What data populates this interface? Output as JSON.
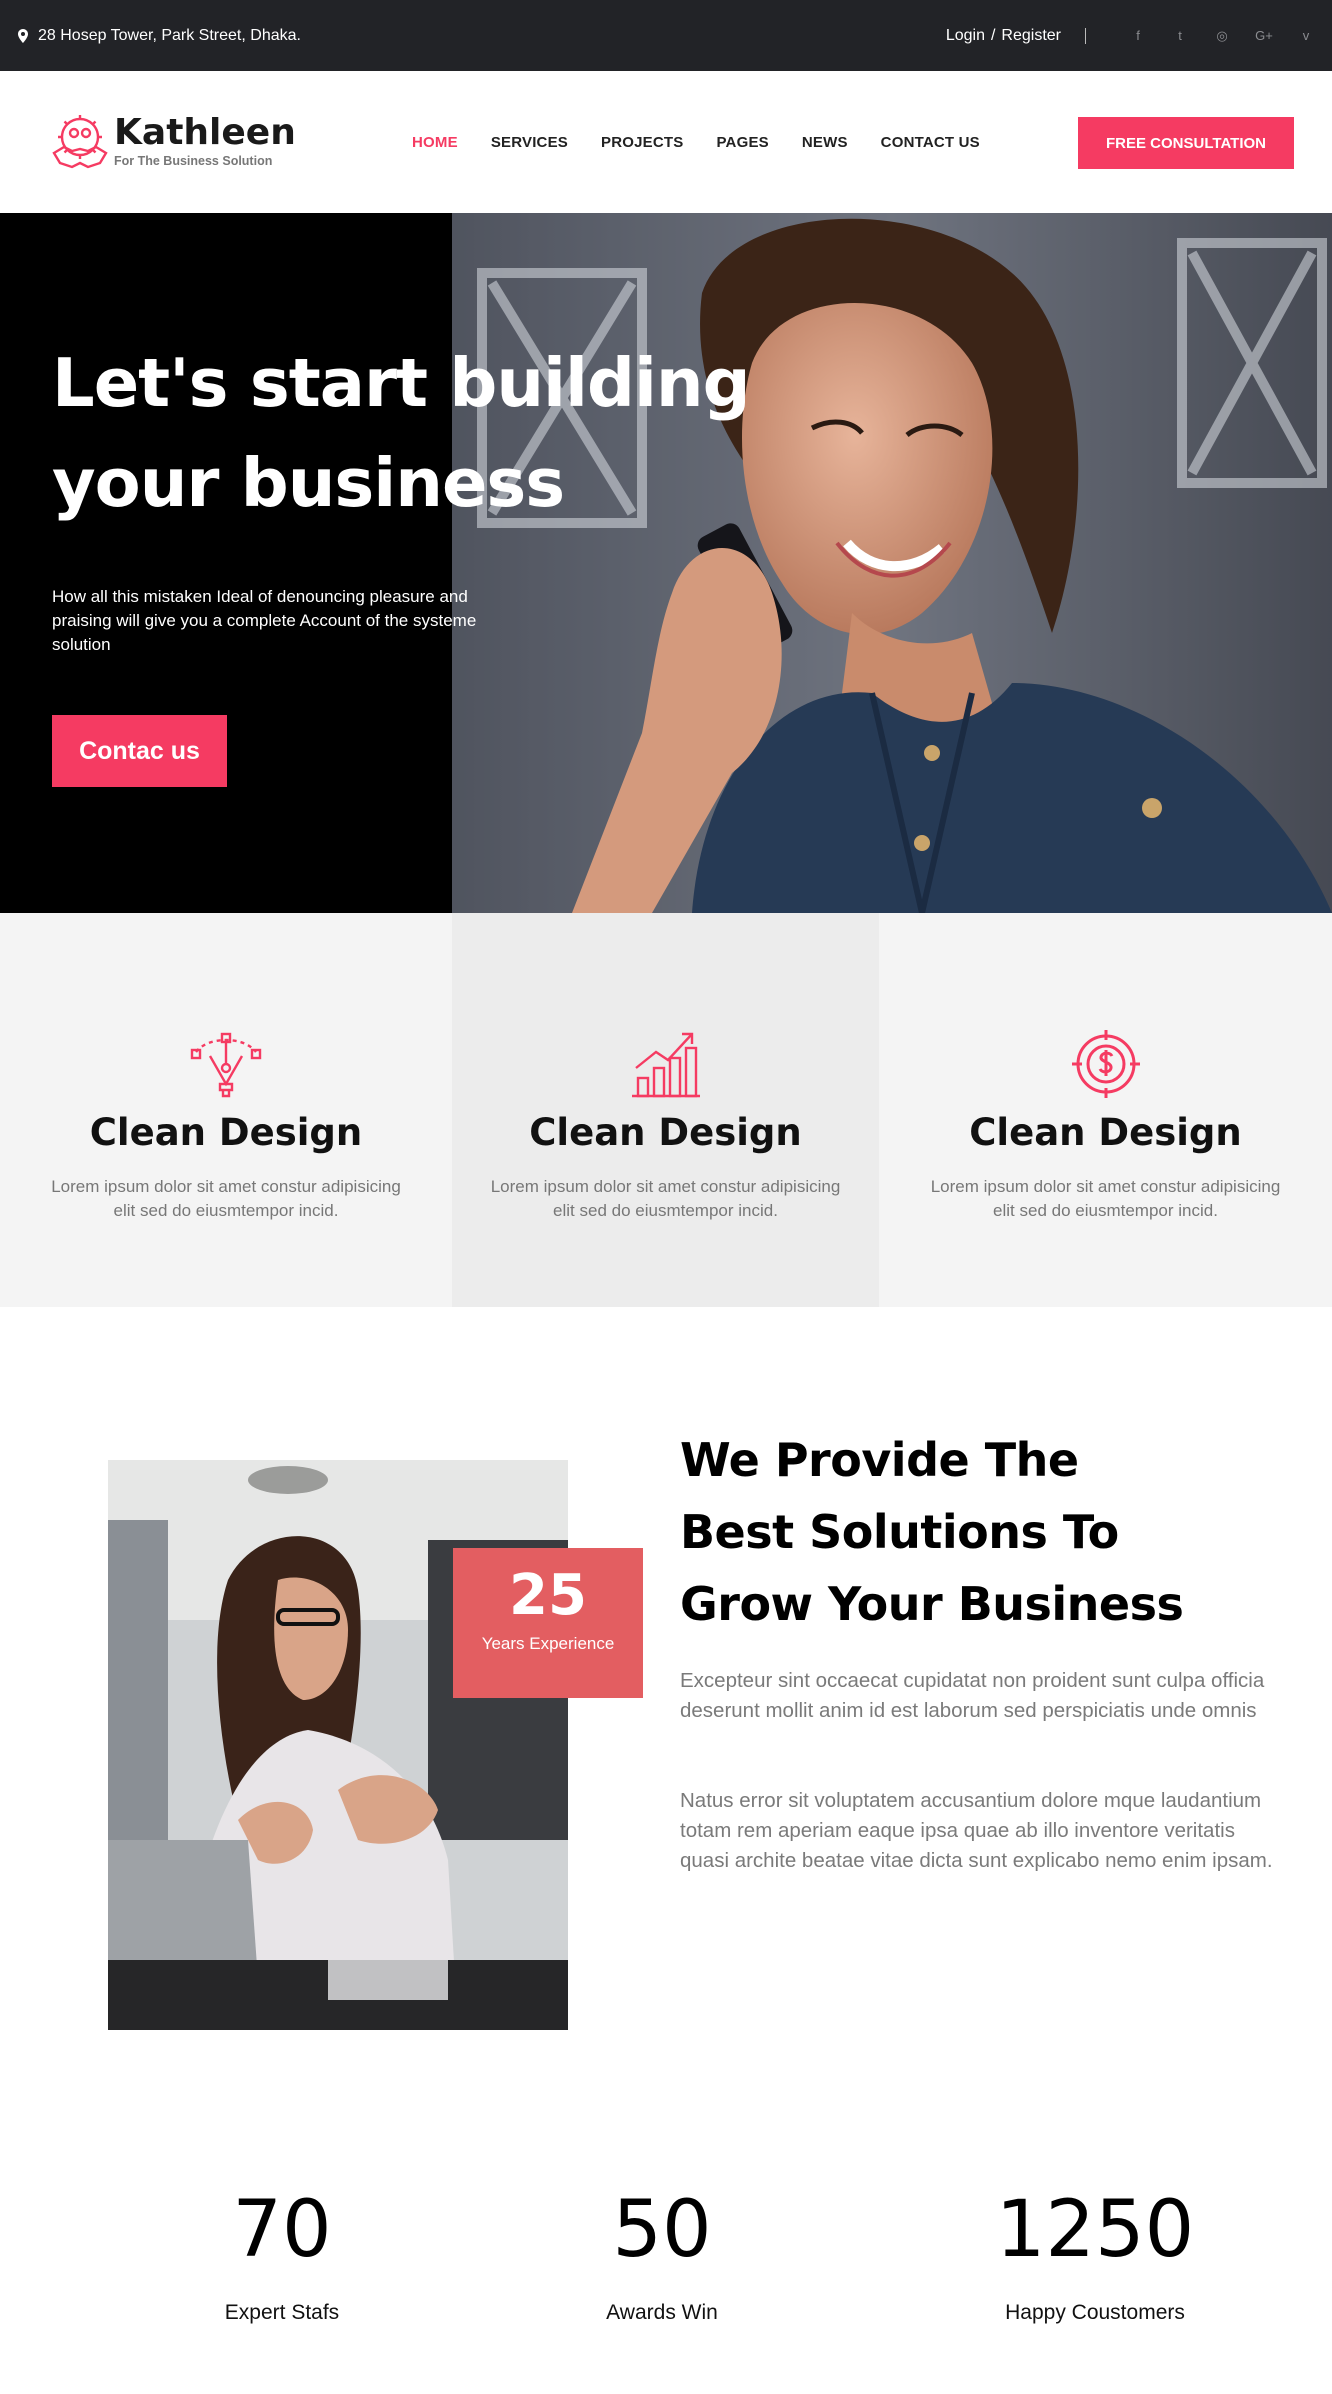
{
  "topbar": {
    "address": "28 Hosep Tower, Park Street, Dhaka.",
    "login": "Login",
    "separator": "/",
    "register": "Register",
    "social": [
      "facebook-icon",
      "twitter-icon",
      "dribbble-icon",
      "google-plus-icon",
      "vimeo-icon"
    ],
    "social_glyphs": [
      "f",
      "t",
      "◎",
      "G+",
      "v"
    ]
  },
  "header": {
    "brand": "Kathleen",
    "tagline": "For The Business Solution",
    "nav": [
      "HOME",
      "SERVICES",
      "PROJECTS",
      "PAGES",
      "NEWS",
      "CONTACT US"
    ],
    "active_nav": "HOME",
    "cta": "FREE CONSULTATION"
  },
  "hero": {
    "title_line1": "Let's start building",
    "title_line2": "your business",
    "lead": "How all this mistaken Ideal of denouncing pleasure  and praising will give you a complete Account of the systeme solution",
    "button": "Contac us"
  },
  "features": [
    {
      "icon": "pen-tool-icon",
      "title": "Clean Design",
      "text": "Lorem ipsum dolor sit amet constur adipisicing elit sed do eiusmtempor incid."
    },
    {
      "icon": "bar-chart-growth-icon",
      "title": "Clean Design",
      "text": "Lorem ipsum dolor sit amet constur adipisicing elit sed do eiusmtempor incid."
    },
    {
      "icon": "dollar-target-icon",
      "title": "Clean Design",
      "text": "Lorem ipsum dolor sit amet constur adipisicing elit sed do eiusmtempor incid."
    }
  ],
  "about": {
    "years": "25",
    "years_label": "Years Experience",
    "title_line1": "We Provide The",
    "title_line2": "Best Solutions To",
    "title_line3": "Grow Your Business",
    "para1": "Excepteur sint occaecat cupidatat non proident sunt culpa officia deserunt mollit anim id est laborum sed perspiciatis unde omnis",
    "para2": "Natus error sit voluptatem accusantium dolore mque laudantium totam rem aperiam eaque ipsa quae ab illo inventore veritatis quasi archite beatae vitae dicta sunt explicabo nemo enim ipsam."
  },
  "stats": [
    {
      "value": "70",
      "label": "Expert Stafs"
    },
    {
      "value": "50",
      "label": "Awards Win"
    },
    {
      "value": "1250",
      "label": "Happy Coustomers"
    }
  ],
  "colors": {
    "accent": "#f53b62",
    "badge": "#e35e61",
    "topbar": "#222327"
  }
}
